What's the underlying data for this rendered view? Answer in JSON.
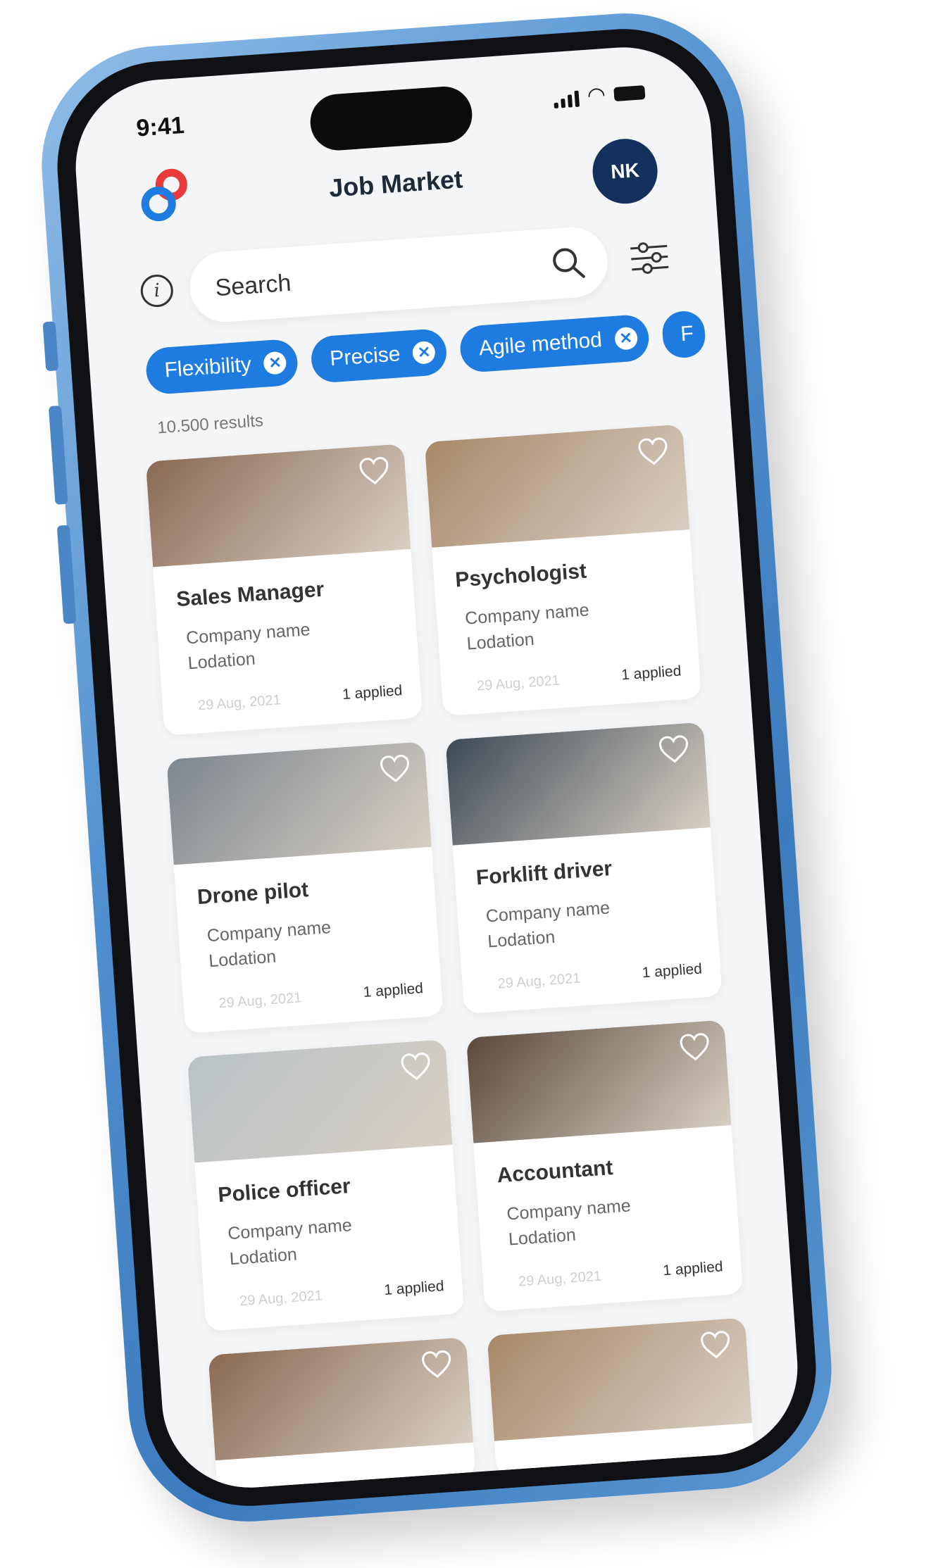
{
  "status_bar": {
    "time": "9:41"
  },
  "header": {
    "title": "Job Market",
    "avatar_initials": "NK"
  },
  "search": {
    "placeholder": "Search",
    "value": ""
  },
  "chips": [
    {
      "label": "Flexibility"
    },
    {
      "label": "Precise"
    },
    {
      "label": "Agile method"
    },
    {
      "label": "F"
    }
  ],
  "results_count": "10.500 results",
  "jobs": [
    {
      "title": "Sales Manager",
      "company": "Company name",
      "location": "Lodation",
      "date": "29 Aug, 2021",
      "applied": "1 applied",
      "image_color": "#8a6a52"
    },
    {
      "title": "Psychologist",
      "company": "Company name",
      "location": "Lodation",
      "date": "29 Aug, 2021",
      "applied": "1 applied",
      "image_color": "#a88868"
    },
    {
      "title": "Drone pilot",
      "company": "Company name",
      "location": "Lodation",
      "date": "29 Aug, 2021",
      "applied": "1 applied",
      "image_color": "#7d868e"
    },
    {
      "title": "Forklift driver",
      "company": "Company name",
      "location": "Lodation",
      "date": "29 Aug, 2021",
      "applied": "1 applied",
      "image_color": "#3e4a55"
    },
    {
      "title": "Police officer",
      "company": "Company name",
      "location": "Lodation",
      "date": "29 Aug, 2021",
      "applied": "1 applied",
      "image_color": "#b9c2c6"
    },
    {
      "title": "Accountant",
      "company": "Company name",
      "location": "Lodation",
      "date": "29 Aug, 2021",
      "applied": "1 applied",
      "image_color": "#5a4a3e"
    },
    {
      "image_color": "#8a6a52"
    },
    {
      "image_color": "#a88868"
    }
  ],
  "colors": {
    "accent": "#1e7be0",
    "avatar_bg": "#13315c",
    "frame": "#4f8fcf"
  }
}
